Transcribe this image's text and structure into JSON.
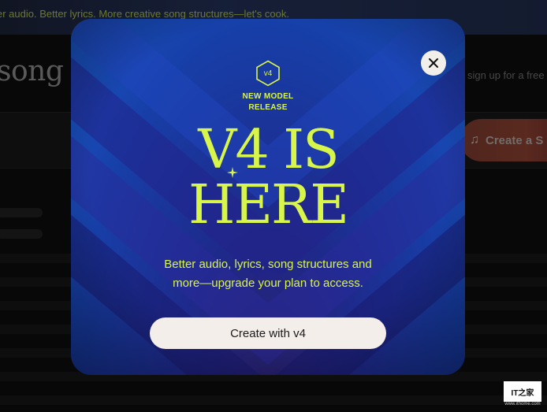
{
  "background": {
    "banner_text": "er audio. Better lyrics. More creative song structures—let's cook.",
    "page_title": "song a",
    "signup_text": "sign up for a free",
    "create_button_label": "Create a S",
    "create_button_icon": "music-note-icon"
  },
  "modal": {
    "close_icon": "close-icon",
    "badge": "v4",
    "release_label_line1": "NEW MODEL",
    "release_label_line2": "RELEASE",
    "headline_line1": "V4 IS",
    "headline_line2": "HERE",
    "description_line1": "Better audio, lyrics, song structures and",
    "description_line2": "more—upgrade your plan to access.",
    "cta_label": "Create with v4",
    "accent_color": "#d8f54a",
    "bg_color": "#1b3fa8"
  },
  "watermark": {
    "label": "IT之家",
    "sub": "www.ithome.com"
  }
}
